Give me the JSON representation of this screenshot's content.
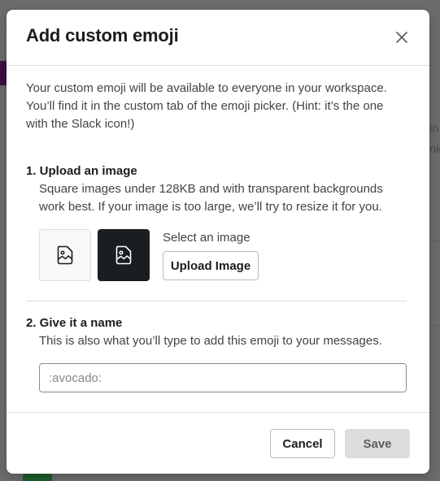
{
  "background": {
    "right_text_lines": [
      "in",
      "nic"
    ]
  },
  "modal": {
    "title": "Add custom emoji",
    "close_icon": "close-icon",
    "intro": "Your custom emoji will be available to everyone in your workspace. You’ll find it in the custom tab of the emoji picker. (Hint: it’s the one with the Slack icon!)",
    "step1": {
      "title": "1. Upload an image",
      "description": "Square images under 128KB and with transparent backgrounds work best. If your image is too large, we’ll try to resize it for you.",
      "preview_icon": "image-icon",
      "select_label": "Select an image",
      "upload_button": "Upload Image"
    },
    "step2": {
      "title": "2. Give it a name",
      "description": "This is also what you’ll type to add this emoji to your messages.",
      "input_value": "",
      "input_placeholder": ":avocado:"
    },
    "footer": {
      "cancel_label": "Cancel",
      "save_label": "Save"
    }
  },
  "colors": {
    "overlay": "#6b6b6b",
    "text_primary": "#1d1c1d",
    "text_secondary": "#454245",
    "save_disabled_bg": "#dddddd",
    "dark_preview_bg": "#1a1d21"
  }
}
